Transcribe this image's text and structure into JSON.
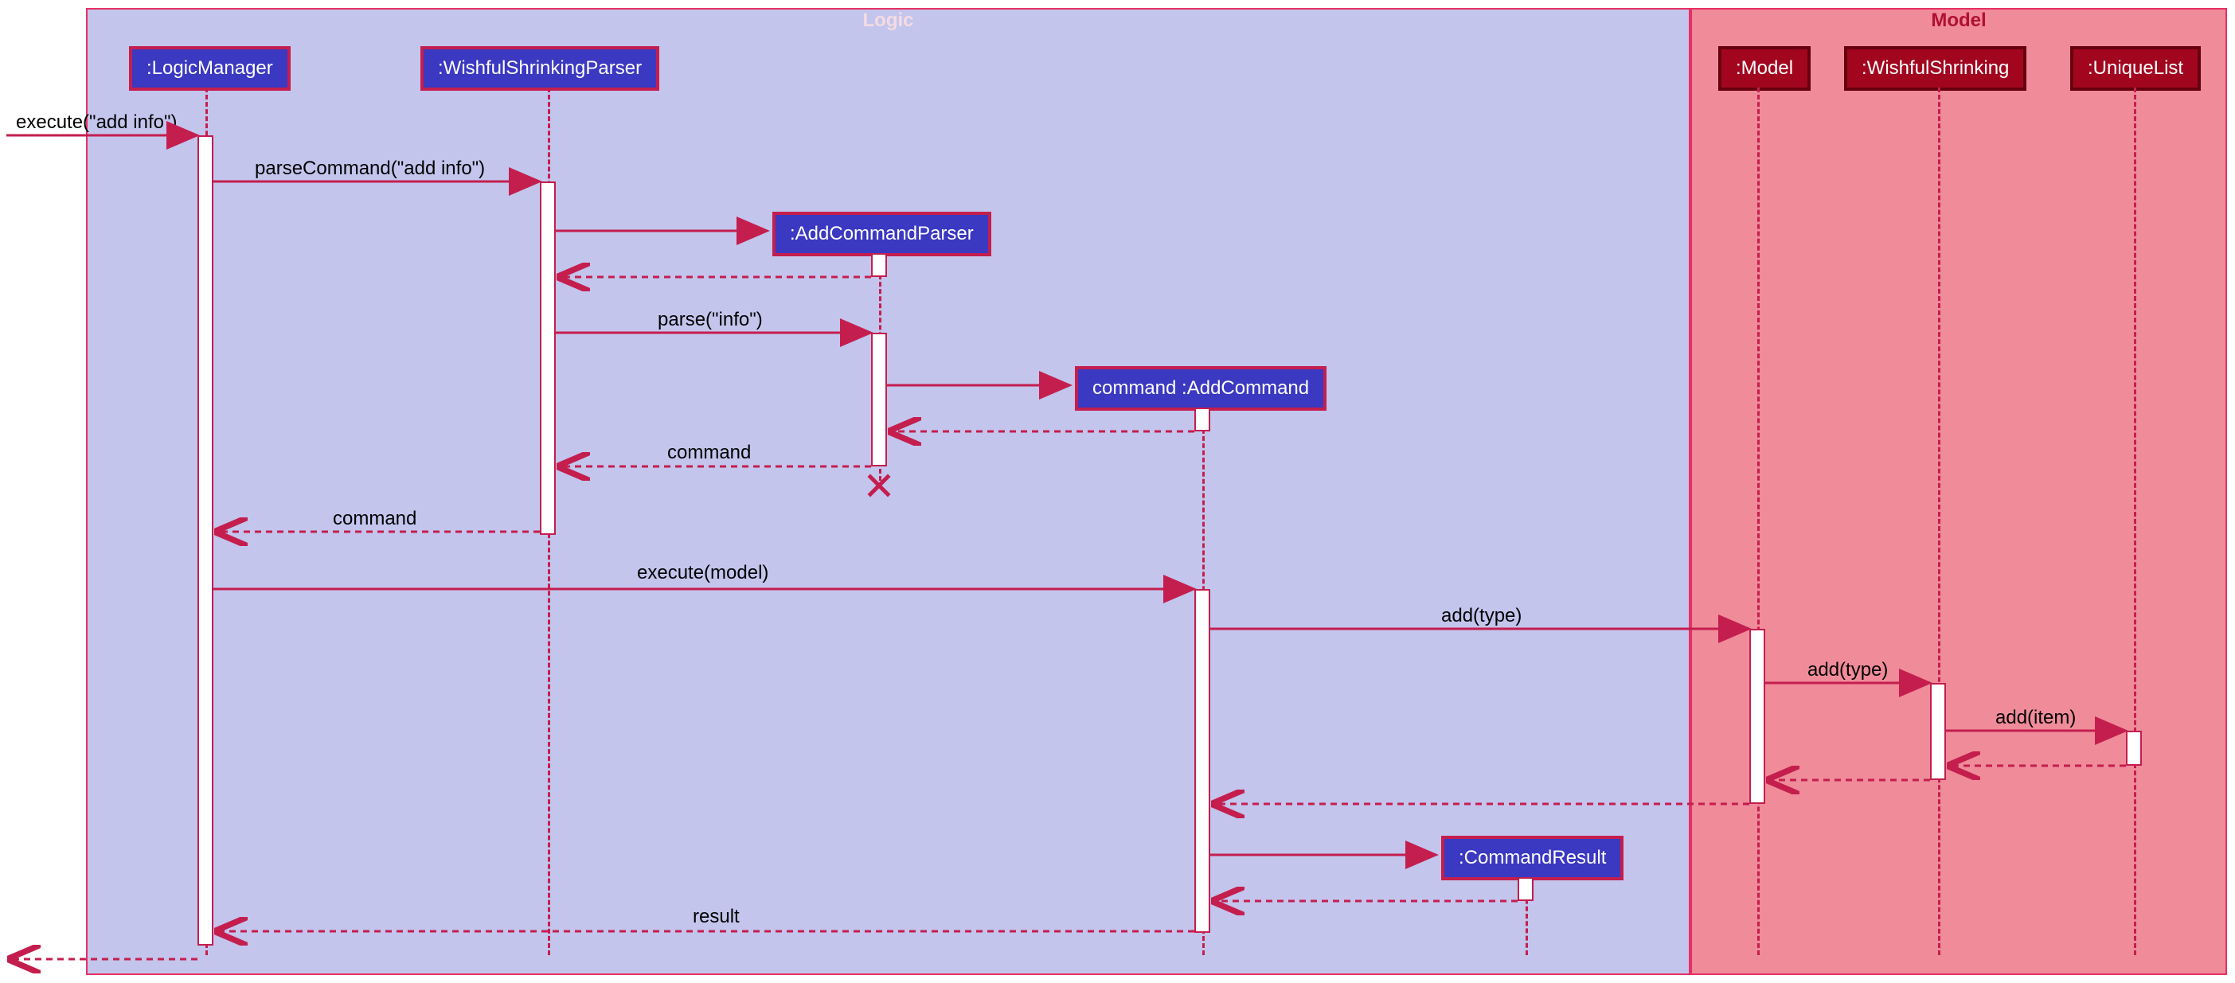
{
  "frames": {
    "logic": "Logic",
    "model": "Model"
  },
  "participants": {
    "logicManager": ":LogicManager",
    "wishfulParser": ":WishfulShrinkingParser",
    "addCommandParser": ":AddCommandParser",
    "addCommand": "command :AddCommand",
    "commandResult": ":CommandResult",
    "model": ":Model",
    "wishfulShrinking": ":WishfulShrinking",
    "uniqueList": ":UniqueList"
  },
  "messages": {
    "m1": "execute(\"add info\")",
    "m2": "parseCommand(\"add info\")",
    "m3": "parse(\"info\")",
    "m4": "command",
    "m5": "command",
    "m6": "execute(model)",
    "m7": "add(type)",
    "m8": "add(type)",
    "m9": "add(item)",
    "m10": "result"
  }
}
